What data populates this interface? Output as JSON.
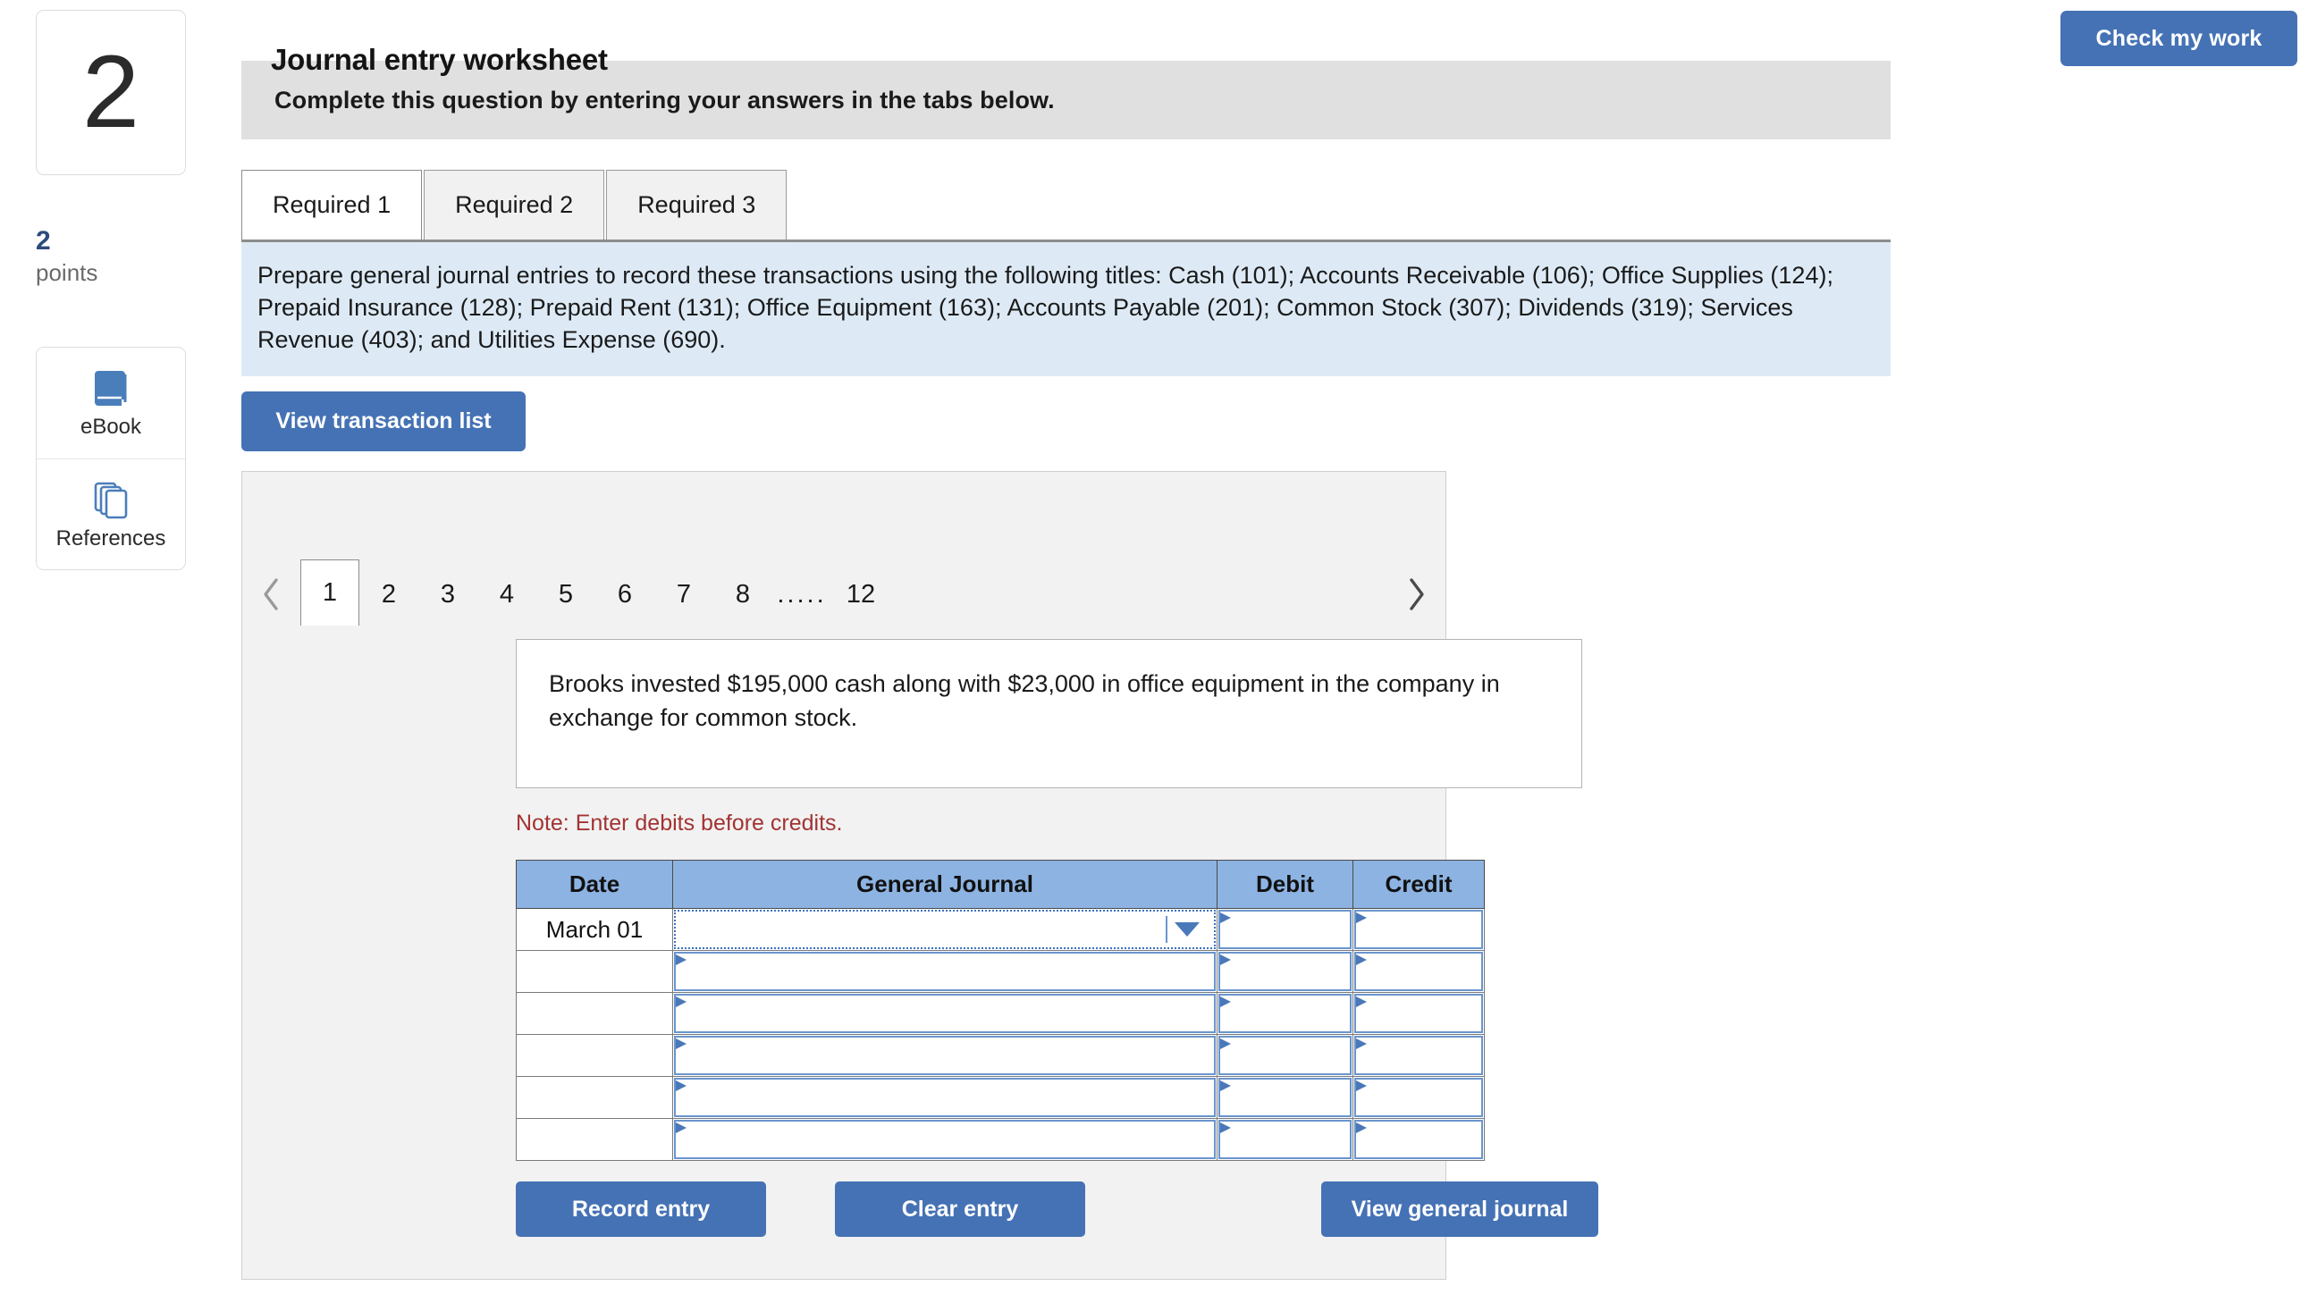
{
  "top_bar": {
    "check_my_work_label": "Check my work"
  },
  "left_rail": {
    "question_number": "2",
    "points_value": "2",
    "points_label": "points",
    "tools": [
      {
        "icon": "book-icon",
        "label": "eBook"
      },
      {
        "icon": "pages-stack-icon",
        "label": "References"
      }
    ]
  },
  "banner": {
    "text": "Complete this question by entering your answers in the tabs below."
  },
  "required_tabs": {
    "items": [
      {
        "label": "Required 1",
        "active": true
      },
      {
        "label": "Required 2",
        "active": false
      },
      {
        "label": "Required 3",
        "active": false
      }
    ]
  },
  "instruction": {
    "text": "Prepare general journal entries to record these transactions using the following titles: Cash (101); Accounts Receivable (106); Office Supplies (124); Prepaid Insurance (128); Prepaid Rent (131); Office Equipment (163); Accounts Payable (201); Common Stock (307); Dividends (319); Services Revenue (403); and Utilities Expense (690)."
  },
  "view_transaction_list": {
    "label": "View transaction list"
  },
  "worksheet": {
    "title": "Journal entry worksheet",
    "pager": {
      "prev_icon": "chevron-left-icon",
      "next_icon": "chevron-right-icon",
      "pages": [
        "1",
        "2",
        "3",
        "4",
        "5",
        "6",
        "7",
        "8"
      ],
      "ellipsis": ".....",
      "last_page": "12",
      "active_page": "1"
    },
    "transaction_description": "Brooks invested $195,000 cash along with $23,000 in office equipment in the company in exchange for common stock.",
    "note": "Note: Enter debits before credits.",
    "table": {
      "headers": [
        "Date",
        "General Journal",
        "Debit",
        "Credit"
      ],
      "rows": [
        {
          "date": "March 01",
          "general_journal": "",
          "debit": "",
          "credit": "",
          "focused": true,
          "has_dropdown": true
        },
        {
          "date": "",
          "general_journal": "",
          "debit": "",
          "credit": "",
          "focused": false,
          "has_dropdown": false
        },
        {
          "date": "",
          "general_journal": "",
          "debit": "",
          "credit": "",
          "focused": false,
          "has_dropdown": false
        },
        {
          "date": "",
          "general_journal": "",
          "debit": "",
          "credit": "",
          "focused": false,
          "has_dropdown": false
        },
        {
          "date": "",
          "general_journal": "",
          "debit": "",
          "credit": "",
          "focused": false,
          "has_dropdown": false
        },
        {
          "date": "",
          "general_journal": "",
          "debit": "",
          "credit": "",
          "focused": false,
          "has_dropdown": false
        }
      ]
    },
    "actions": {
      "record_entry": "Record entry",
      "clear_entry": "Clear entry",
      "view_general_journal": "View general journal"
    }
  },
  "colors": {
    "primary_button": "#4572b4",
    "banner_bg": "#e0e0e0",
    "instruction_bg": "#ddeaf6",
    "table_header_bg": "#8db3e2",
    "note_red": "#a33333",
    "points_blue": "#2c4b7c",
    "panel_bg": "#f2f2f2"
  }
}
